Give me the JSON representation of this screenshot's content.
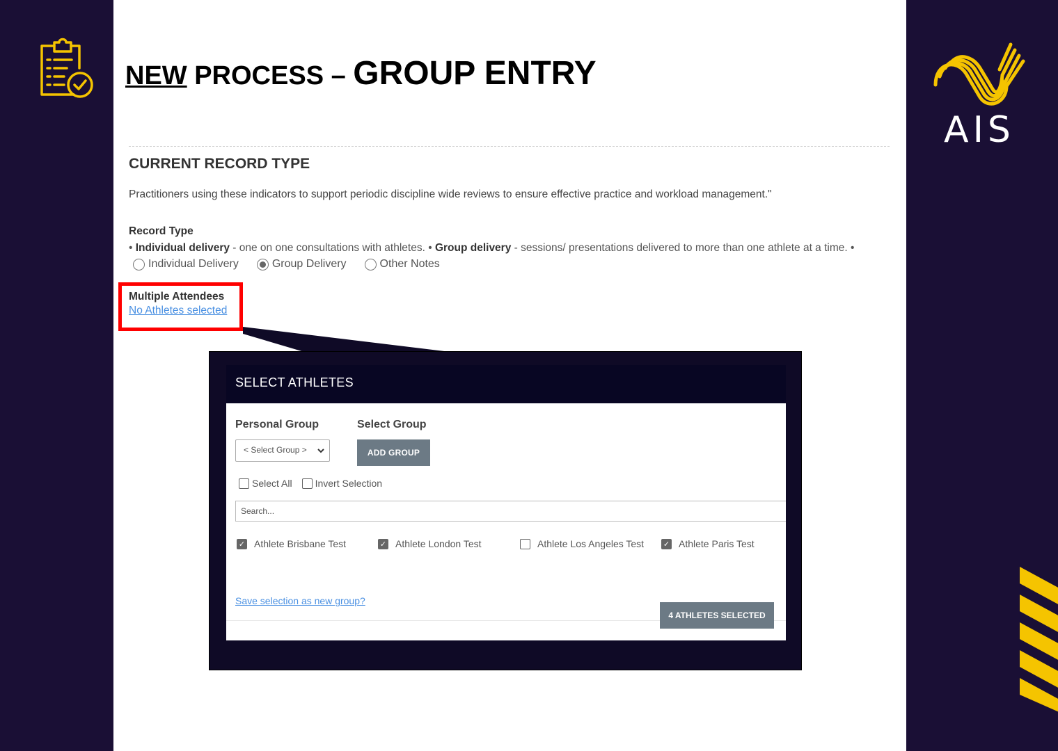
{
  "slide": {
    "title_new": "NEW",
    "title_process": " PROCESS – ",
    "title_group_entry": "GROUP ENTRY",
    "logo_text": "AIS",
    "colors": {
      "navy": "#1a0f35",
      "gold": "#f5c400",
      "highlight": "#ff0000"
    }
  },
  "form": {
    "section_heading": "CURRENT RECORD TYPE",
    "description": "Practitioners using these indicators to support periodic discipline wide reviews to ensure effective practice and workload management.\"",
    "record_type_label": "Record Type",
    "record_type_help": {
      "bullet1": "• ",
      "individual_bold": "Individual delivery",
      "individual_text": " - one on one consultations with athletes. • ",
      "group_bold": "Group delivery",
      "group_text": " - sessions/ presentations delivered to more than one athlete at a time. •"
    },
    "radio_options": [
      {
        "label": "Individual Delivery",
        "selected": false
      },
      {
        "label": "Group Delivery",
        "selected": true
      },
      {
        "label": "Other Notes",
        "selected": false
      }
    ],
    "multiple_attendees_label": "Multiple Attendees",
    "no_athletes_link": "No Athletes selected"
  },
  "modal": {
    "title": "SELECT ATHLETES",
    "personal_group_label": "Personal Group",
    "select_group_label": "Select Group",
    "select_value": "< Select Group >",
    "add_group_button": "ADD GROUP",
    "select_all": "Select All",
    "invert_selection": "Invert Selection",
    "search_placeholder": "Search...",
    "athletes": [
      {
        "name": "Athlete Brisbane Test",
        "checked": true
      },
      {
        "name": "Athlete London Test",
        "checked": true
      },
      {
        "name": "Athlete Los Angeles Test",
        "checked": false
      },
      {
        "name": "Athlete Paris Test",
        "checked": true
      }
    ],
    "save_link": "Save selection as new group?",
    "selected_button": "4 ATHLETES SELECTED"
  }
}
